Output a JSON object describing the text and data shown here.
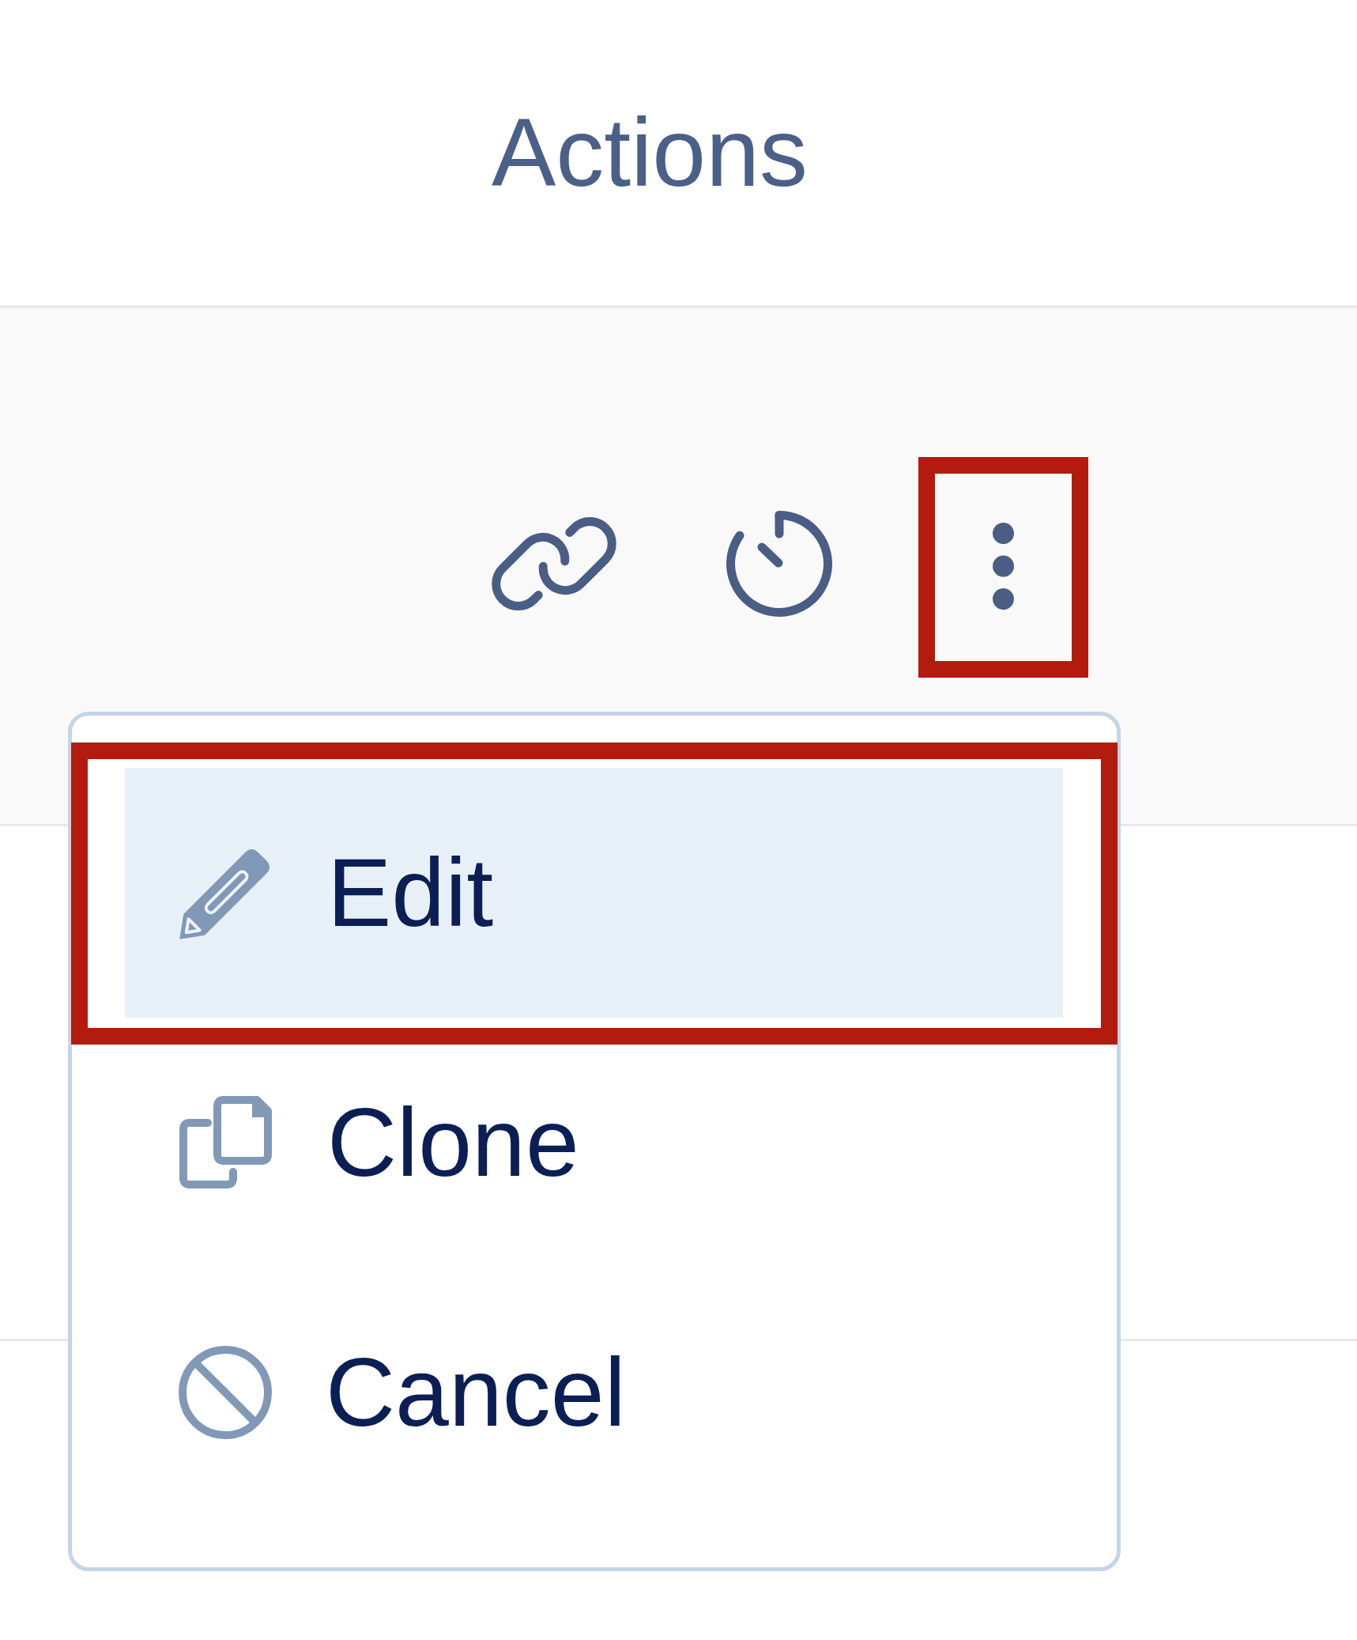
{
  "table": {
    "column_header": "Actions",
    "rows": [
      {
        "actions": [
          {
            "kind": "link",
            "highlighted": false
          },
          {
            "kind": "timer",
            "highlighted": false
          },
          {
            "kind": "more",
            "highlighted": true
          }
        ]
      }
    ]
  },
  "menu": {
    "items": [
      {
        "kind": "edit",
        "label": "Edit",
        "selected": true,
        "highlighted": true
      },
      {
        "kind": "clone",
        "label": "Clone",
        "selected": false,
        "highlighted": false
      },
      {
        "kind": "cancel",
        "label": "Cancel",
        "selected": false,
        "highlighted": false
      }
    ]
  }
}
